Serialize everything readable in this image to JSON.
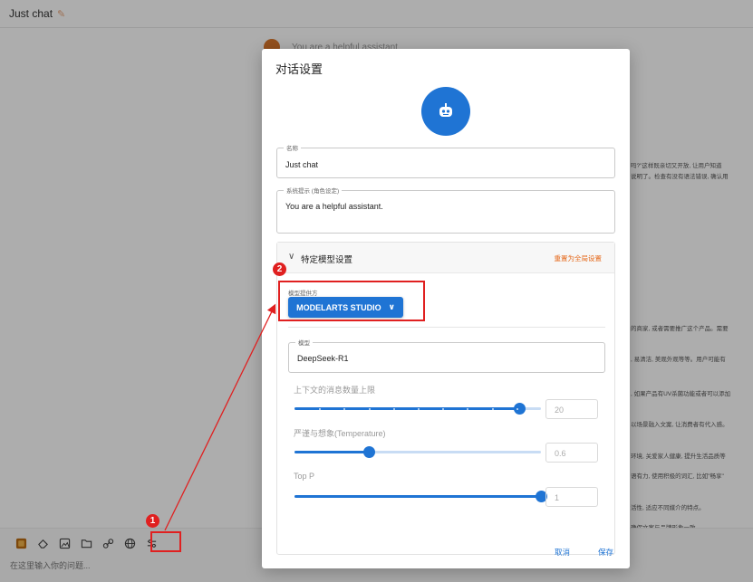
{
  "app": {
    "header_title": "Just chat",
    "bg_message_fragment": "You are a helpful assistant",
    "input_placeholder": "在这里输入你的问题...",
    "bg_snippets": [
      "吗?\"这样既亲切又开放, 让用户知道",
      "说明了。检查有没有语法错误, 确认用",
      "的商家, 或者需要推广这个产品。需要",
      ", 易清洁, 美观外观等等。用户可能有",
      ", 如果产品有UV杀菌功能或者可以添加",
      "以场景融入文案, 让消费者有代入感。",
      "环境, 关爱家人健康, 提升生活品质等",
      "语有力, 使用积极的词汇, 比如\"畅享\"",
      "活性, 适应不同媒介的特点。",
      "确保文案与品牌形象一致。"
    ]
  },
  "dialog": {
    "title": "对话设置",
    "name_legend": "名称",
    "name_value": "Just chat",
    "system_legend": "系统提示 (角色设定)",
    "system_value": "You are a helpful assistant.",
    "section_title": "特定模型设置",
    "reset_label": "重置为全局设置",
    "provider_label": "模型提供方",
    "provider_value": "MODELARTS STUDIO",
    "model_legend": "模型",
    "model_value": "DeepSeek-R1",
    "sliders": [
      {
        "label": "上下文的消息数量上限",
        "value": "20",
        "fraction": 0.91
      },
      {
        "label": "严谨与想象(Temperature)",
        "value": "0.6",
        "fraction": 0.3
      },
      {
        "label": "Top P",
        "value": "1",
        "fraction": 1.0
      }
    ],
    "cancel_label": "取消",
    "save_label": "保存"
  },
  "callouts": [
    "1",
    "2"
  ],
  "colors": {
    "accent": "#1f74d4",
    "reset_link": "#e56a1c",
    "annotation": "#e02020"
  },
  "icons": [
    "attachment-icon",
    "eraser-icon",
    "image-icon",
    "folder-icon",
    "link-icon",
    "globe-icon",
    "settings-sliders-icon",
    "robot-icon"
  ]
}
